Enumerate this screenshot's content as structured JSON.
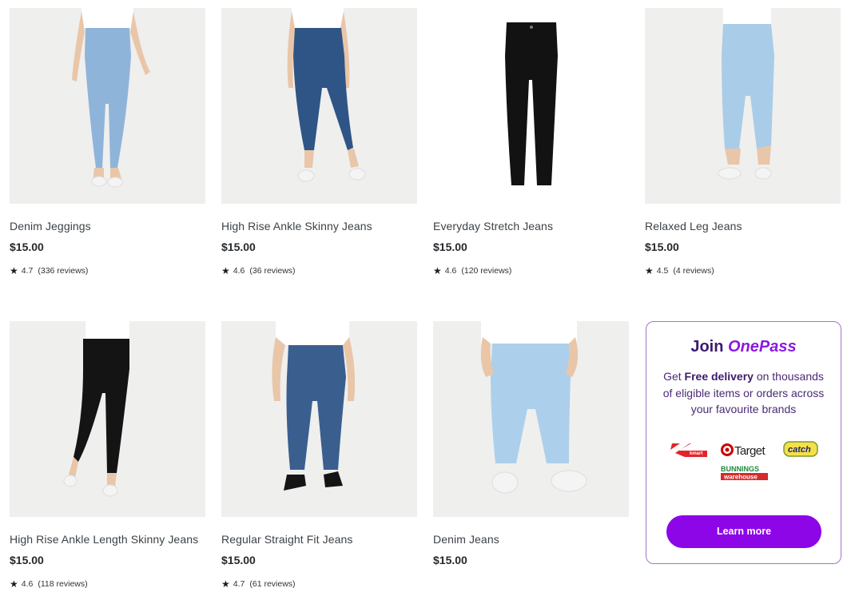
{
  "products": [
    {
      "name": "Denim Jeggings",
      "price": "$15.00",
      "rating": "4.7",
      "reviews": "(336 reviews)",
      "image": "light-wash-jeggings-model-photo"
    },
    {
      "name": "High Rise Ankle Skinny Jeans",
      "price": "$15.00",
      "rating": "4.6",
      "reviews": "(36 reviews)",
      "image": "dark-blue-skinny-jeans-model-photo"
    },
    {
      "name": "Everyday Stretch Jeans",
      "price": "$15.00",
      "rating": "4.6",
      "reviews": "(120 reviews)",
      "image": "black-jeans-flatlay-photo"
    },
    {
      "name": "Relaxed Leg Jeans",
      "price": "$15.00",
      "rating": "4.5",
      "reviews": "(4 reviews)",
      "image": "light-wash-relaxed-jeans-model-photo"
    },
    {
      "name": "High Rise Ankle Length Skinny Jeans",
      "price": "$15.00",
      "rating": "4.6",
      "reviews": "(118 reviews)",
      "image": "black-skinny-jeans-model-photo"
    },
    {
      "name": "Regular Straight Fit Jeans",
      "price": "$15.00",
      "rating": "4.7",
      "reviews": "(61 reviews)",
      "image": "mens-mid-blue-straight-jeans-photo"
    },
    {
      "name": "Denim Jeans",
      "price": "$15.00",
      "image": "kids-light-wash-jeans-photo"
    }
  ],
  "promo": {
    "title_prefix": "Join",
    "title_brand": "OnePass",
    "desc_prefix": "Get",
    "desc_bold": "Free delivery",
    "desc_suffix": "on thousands of eligible items or orders across your favourite brands",
    "logos": {
      "kmart": "kmart",
      "target": "Target",
      "catch": "catch",
      "bunnings_top": "BUNNINGS",
      "bunnings_bottom": "warehouse"
    },
    "button": "Learn more"
  },
  "colors": {
    "accent": "#8c06e8",
    "promo_border": "#a872c9",
    "promo_text": "#3b1b6e",
    "image_bg": "#efefee"
  }
}
